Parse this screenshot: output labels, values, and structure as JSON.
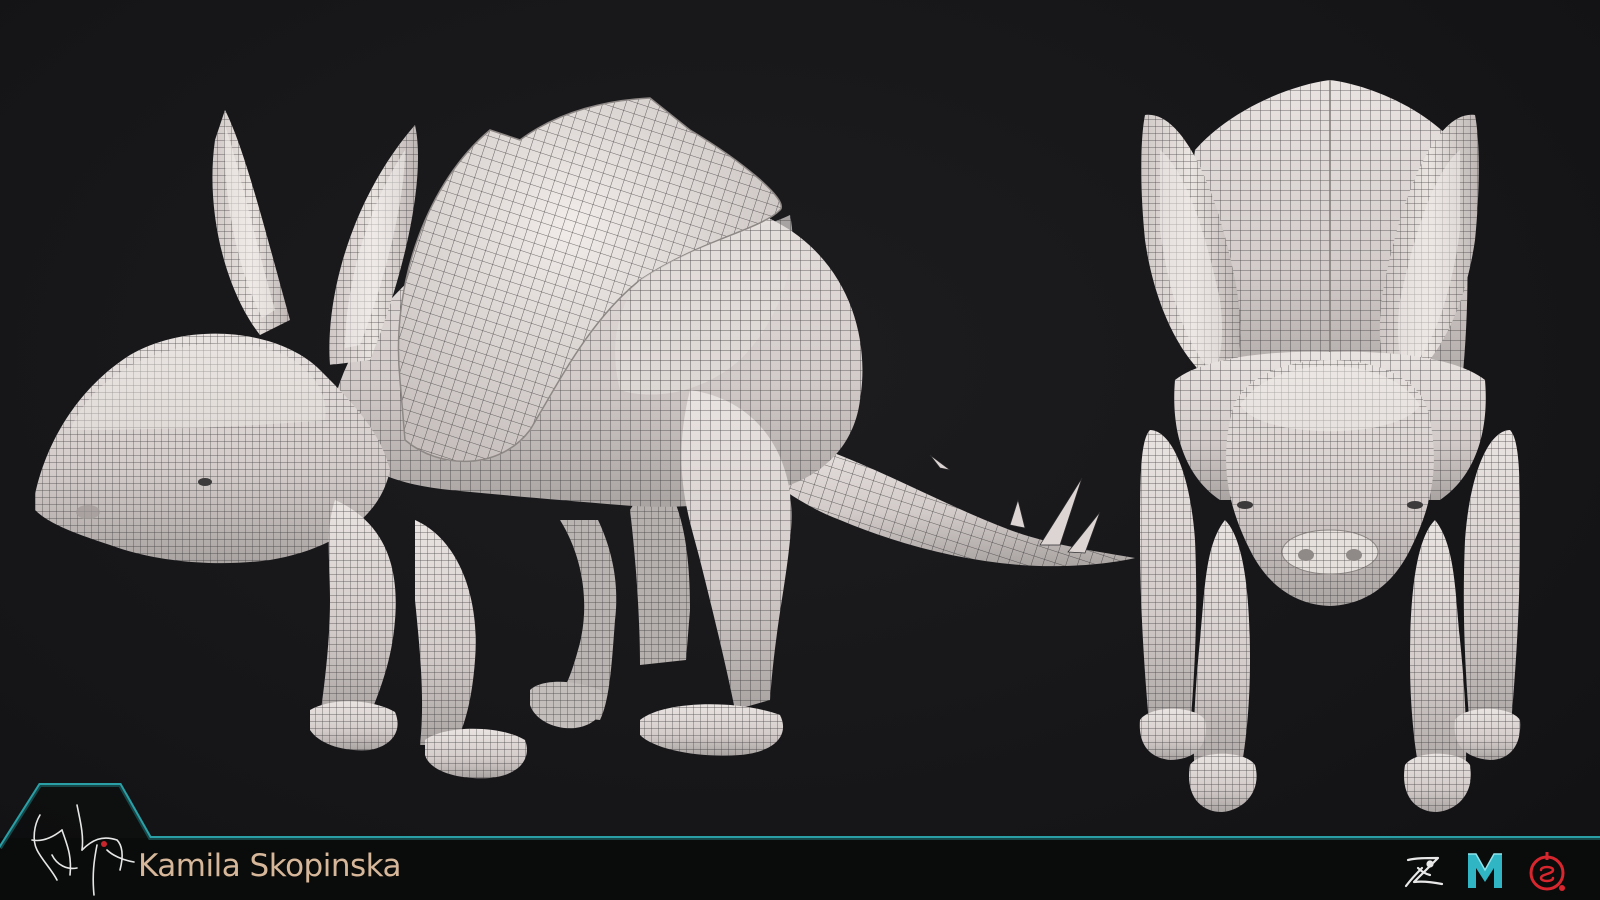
{
  "artist": {
    "name": "Kamila Skopinska"
  },
  "views": [
    {
      "name": "side-view",
      "subject": "quadruped creature wireframe render"
    },
    {
      "name": "front-view",
      "subject": "quadruped creature wireframe render"
    }
  ],
  "tools": [
    {
      "icon": "zbrush-icon",
      "color": "#e8e8e8"
    },
    {
      "icon": "maya-icon",
      "color": "#2fb5c4"
    },
    {
      "icon": "substance-painter-icon",
      "color": "#d8262e"
    }
  ],
  "colors": {
    "background": "#151517",
    "accent": "#2aa0a6",
    "signature": "#d6b79a",
    "mesh_fill": "#d9d2cf",
    "wireframe": "#2b2a2c"
  }
}
